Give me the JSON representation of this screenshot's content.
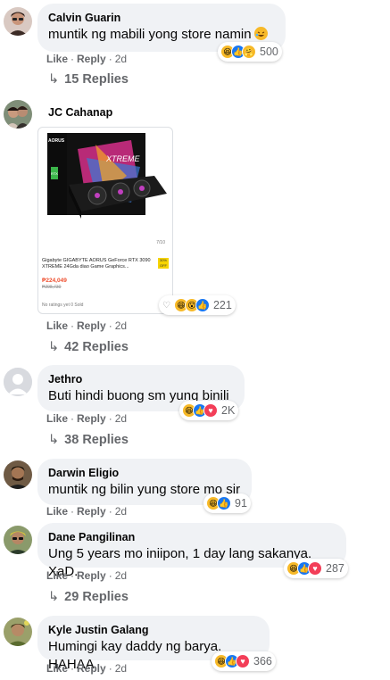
{
  "comments": [
    {
      "author": "Calvin Guarin",
      "text": "muntik ng mabili yong store namin",
      "reaction_count": "500",
      "like": "Like",
      "reply": "Reply",
      "time": "2d",
      "replies": "15 Replies"
    },
    {
      "author": "JC Cahanap",
      "reaction_count": "221",
      "like": "Like",
      "reply": "Reply",
      "time": "2d",
      "replies": "42 Replies",
      "product": {
        "name": "Gigabyte GIGABYTE AORUS GeForce RTX 3090 XTREME 24Gda diao Game Graphics...",
        "price": "₱224,049",
        "old_price": "₱298,730",
        "meta": "No ratings yet   0 Sold",
        "page": "7/10",
        "badge": "30% OFF",
        "box_brand": "AORUS",
        "box_model": "XTREME",
        "box_rtx": "RTX"
      }
    },
    {
      "author": "Jethro",
      "text": "Buti hindi buong sm yung binili",
      "reaction_count": "2K",
      "like": "Like",
      "reply": "Reply",
      "time": "2d",
      "replies": "38 Replies"
    },
    {
      "author": "Darwin Eligio",
      "text": "muntik ng bilin yung store mo sir",
      "reaction_count": "91",
      "like": "Like",
      "reply": "Reply",
      "time": "2d"
    },
    {
      "author": "Dane Pangilinan",
      "text": "Ung 5 years mo iniipon, 1 day lang sakanya. XaD.",
      "reaction_count": "287",
      "like": "Like",
      "reply": "Reply",
      "time": "2d",
      "replies": "29 Replies"
    },
    {
      "author": "Kyle Justin Galang",
      "text": "Humingi kay daddy ng barya. HAHAA",
      "reaction_count": "366",
      "like": "Like",
      "reply": "Reply",
      "time": "2d"
    }
  ],
  "colors": {
    "bubble": "#f0f2f5",
    "secondary_text": "#65676b",
    "like_blue": "#1877f2",
    "haha_yellow": "#f7b928",
    "love_red": "#f33e58"
  },
  "icons": {
    "haha": "haha-reaction-icon",
    "like": "like-reaction-icon",
    "wow": "wow-reaction-icon",
    "love": "love-reaction-icon",
    "care": "care-reaction-icon",
    "reply_arrow": "reply-arrow-icon"
  }
}
